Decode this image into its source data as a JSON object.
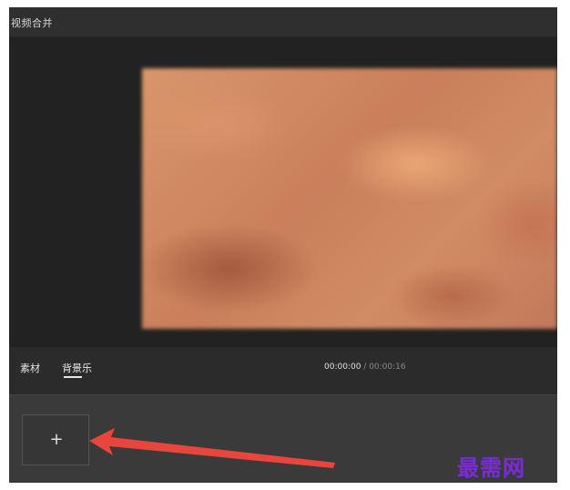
{
  "window": {
    "title": "视频合并"
  },
  "tabs": [
    {
      "label": "素材",
      "active": false
    },
    {
      "label": "背景乐",
      "active": true
    }
  ],
  "playback": {
    "current_time": "00:00:00",
    "separator": " / ",
    "total_time": "00:00:16"
  },
  "timeline": {
    "add_icon": "plus-icon",
    "add_symbol": "+"
  },
  "annotation": {
    "arrow_color": "#e8453c"
  },
  "watermark": {
    "text": "最需网",
    "color": "#7b2bd6"
  }
}
